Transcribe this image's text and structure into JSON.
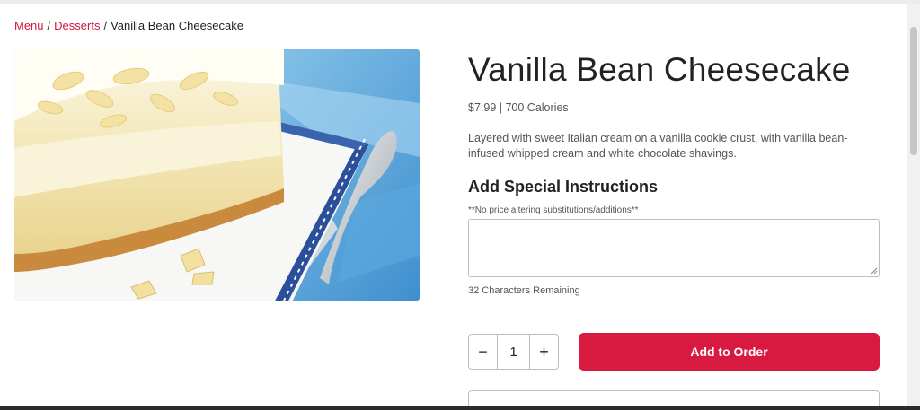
{
  "breadcrumb": {
    "items": [
      "Menu",
      "Desserts"
    ],
    "separator": "/",
    "current": "Vanilla Bean Cheesecake"
  },
  "product": {
    "title": "Vanilla Bean Cheesecake",
    "price_calories": "$7.99 | 700 Calories",
    "description": "Layered with sweet Italian cream on a vanilla cookie crust, with vanilla bean-infused whipped cream and white chocolate shavings.",
    "image_icon": "cheesecake-photo"
  },
  "instructions": {
    "title": "Add Special Instructions",
    "note": "**No price altering substitutions/additions**",
    "value": "",
    "remaining": "32 Characters Remaining"
  },
  "quantity": {
    "minus": "−",
    "value": "1",
    "plus": "+"
  },
  "actions": {
    "add_label": "Add to Order"
  },
  "colors": {
    "accent": "#d91a40",
    "link": "#d3193d"
  }
}
